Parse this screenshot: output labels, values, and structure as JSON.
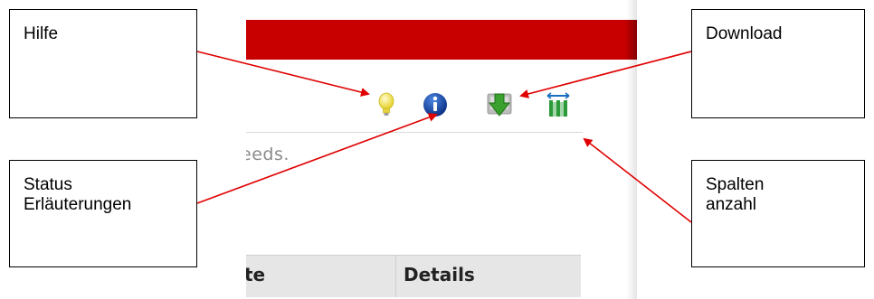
{
  "app": {
    "partial_text": "eeds.",
    "table_headers": [
      "te",
      "Details"
    ]
  },
  "toolbar": {
    "icons": [
      {
        "name": "lightbulb-icon",
        "color": "#f2e24a"
      },
      {
        "name": "info-icon",
        "color": "#0b3f9e"
      },
      {
        "name": "download-icon",
        "color": "#3aa12e"
      },
      {
        "name": "columns-icon",
        "color": "#1a6fc0"
      }
    ]
  },
  "callouts": {
    "hilfe": {
      "lines": [
        "Hilfe"
      ]
    },
    "status": {
      "lines": [
        "Status",
        "Erläuterungen"
      ]
    },
    "download": {
      "lines": [
        "Download"
      ]
    },
    "spalten": {
      "lines": [
        "Spalten",
        "anzahl"
      ]
    }
  },
  "colors": {
    "banner": "#c80000",
    "arrow": "#e00000"
  }
}
